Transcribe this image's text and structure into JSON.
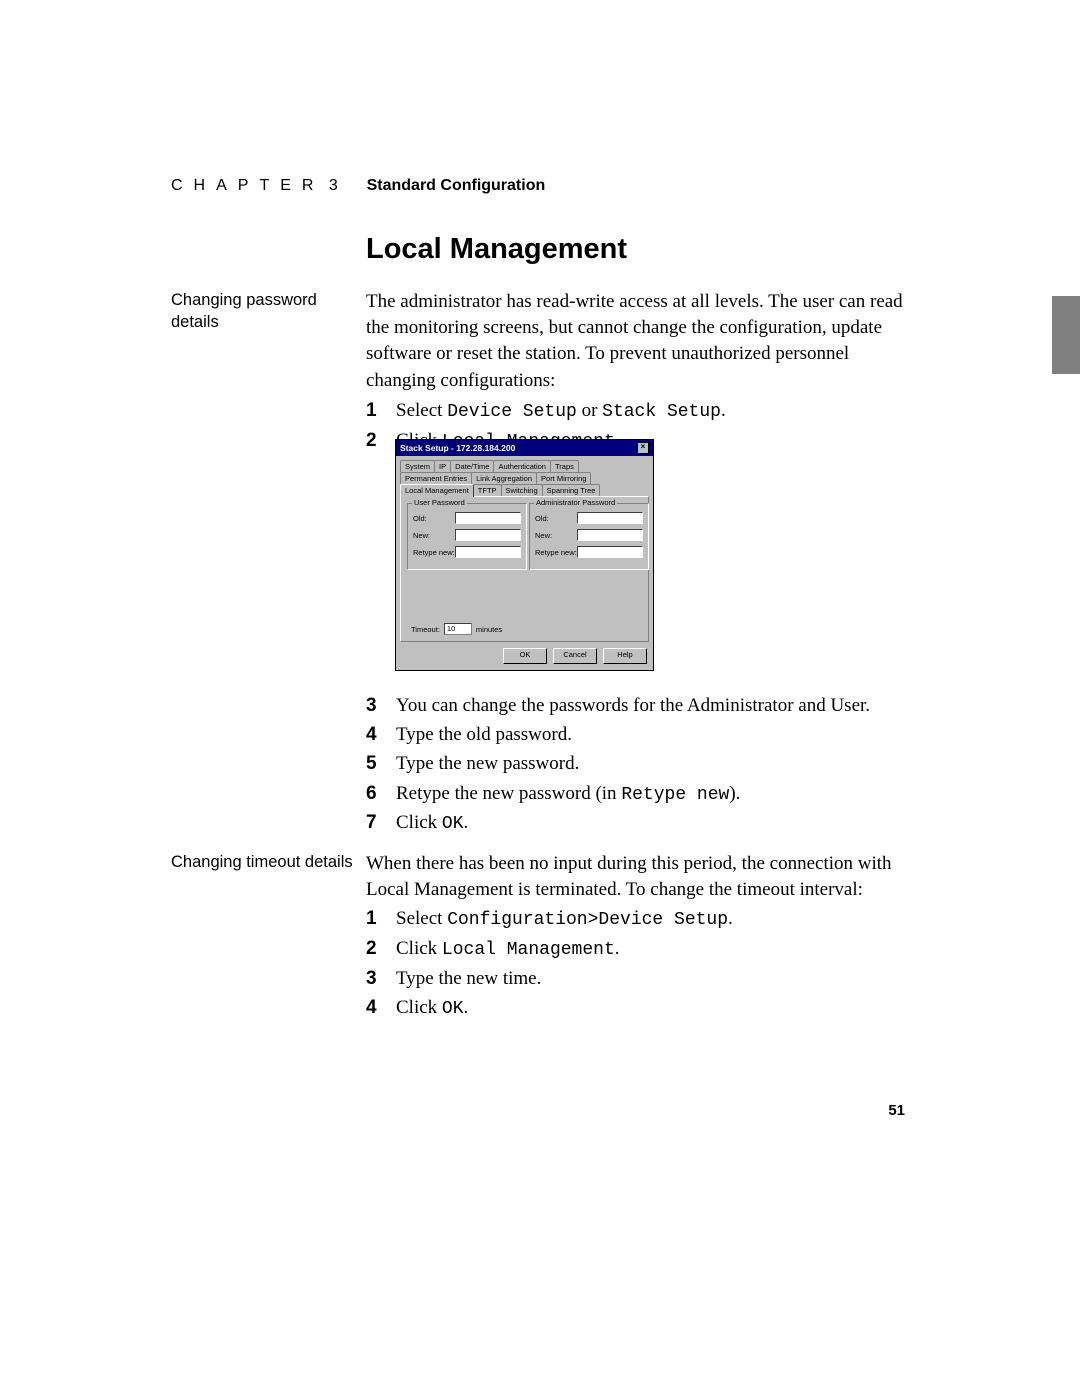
{
  "header": {
    "chapter_word": "CHAPTER",
    "chapter_num": "3",
    "chapter_title": "Standard Configuration"
  },
  "section_title": "Local Management",
  "margin_notes": {
    "a": "Changing password details",
    "b": "Changing timeout details"
  },
  "body": {
    "intro_a": "The administrator has read-write access at all levels. The user can read the monitoring screens, but cannot change the configuration, update software or reset the station. To prevent unauthorized personnel changing configurations:",
    "intro_b": "When there has been no input during this period, the connection with Local Management is terminated. To change the timeout interval:"
  },
  "steps_a1": [
    {
      "n": "1",
      "pre": "Select ",
      "code": "Device Setup",
      "mid": " or ",
      "code2": "Stack Setup",
      "post": "."
    },
    {
      "n": "2",
      "pre": "Click ",
      "code": "Local Management",
      "post": "."
    }
  ],
  "steps_a2": [
    {
      "n": "3",
      "text": "You can change the passwords for the Administrator and User."
    },
    {
      "n": "4",
      "text": "Type the old password."
    },
    {
      "n": "5",
      "text": "Type the new password."
    },
    {
      "n": "6",
      "pre": "Retype the new password (in ",
      "code": "Retype new",
      "post": ")."
    },
    {
      "n": "7",
      "pre": "Click ",
      "code": "OK",
      "post": "."
    }
  ],
  "steps_b": [
    {
      "n": "1",
      "pre": "Select ",
      "code": "Configuration>Device Setup",
      "post": "."
    },
    {
      "n": "2",
      "pre": "Click ",
      "code": "Local Management",
      "post": "."
    },
    {
      "n": "3",
      "text": "Type the new time."
    },
    {
      "n": "4",
      "pre": "Click ",
      "code": "OK",
      "post": "."
    }
  ],
  "dialog": {
    "title": "Stack Setup - 172.28.184.200",
    "tabs_row1": [
      "System",
      "IP",
      "Date/Time",
      "Authentication",
      "Traps"
    ],
    "tabs_row2": [
      "Permanent Entries",
      "Link Aggregation",
      "Port Mirroring"
    ],
    "tabs_row3": [
      "Local Management",
      "TFTP",
      "Switching",
      "Spanning Tree"
    ],
    "active_tab": "Local Management",
    "group_user": "User Password",
    "group_admin": "Administrator Password",
    "field_old": "Old:",
    "field_new": "New:",
    "field_retype": "Retype new:",
    "timeout_label": "Timeout:",
    "timeout_value": "10",
    "timeout_unit": "minutes",
    "btn_ok": "OK",
    "btn_cancel": "Cancel",
    "btn_help": "Help"
  },
  "page_number": "51"
}
